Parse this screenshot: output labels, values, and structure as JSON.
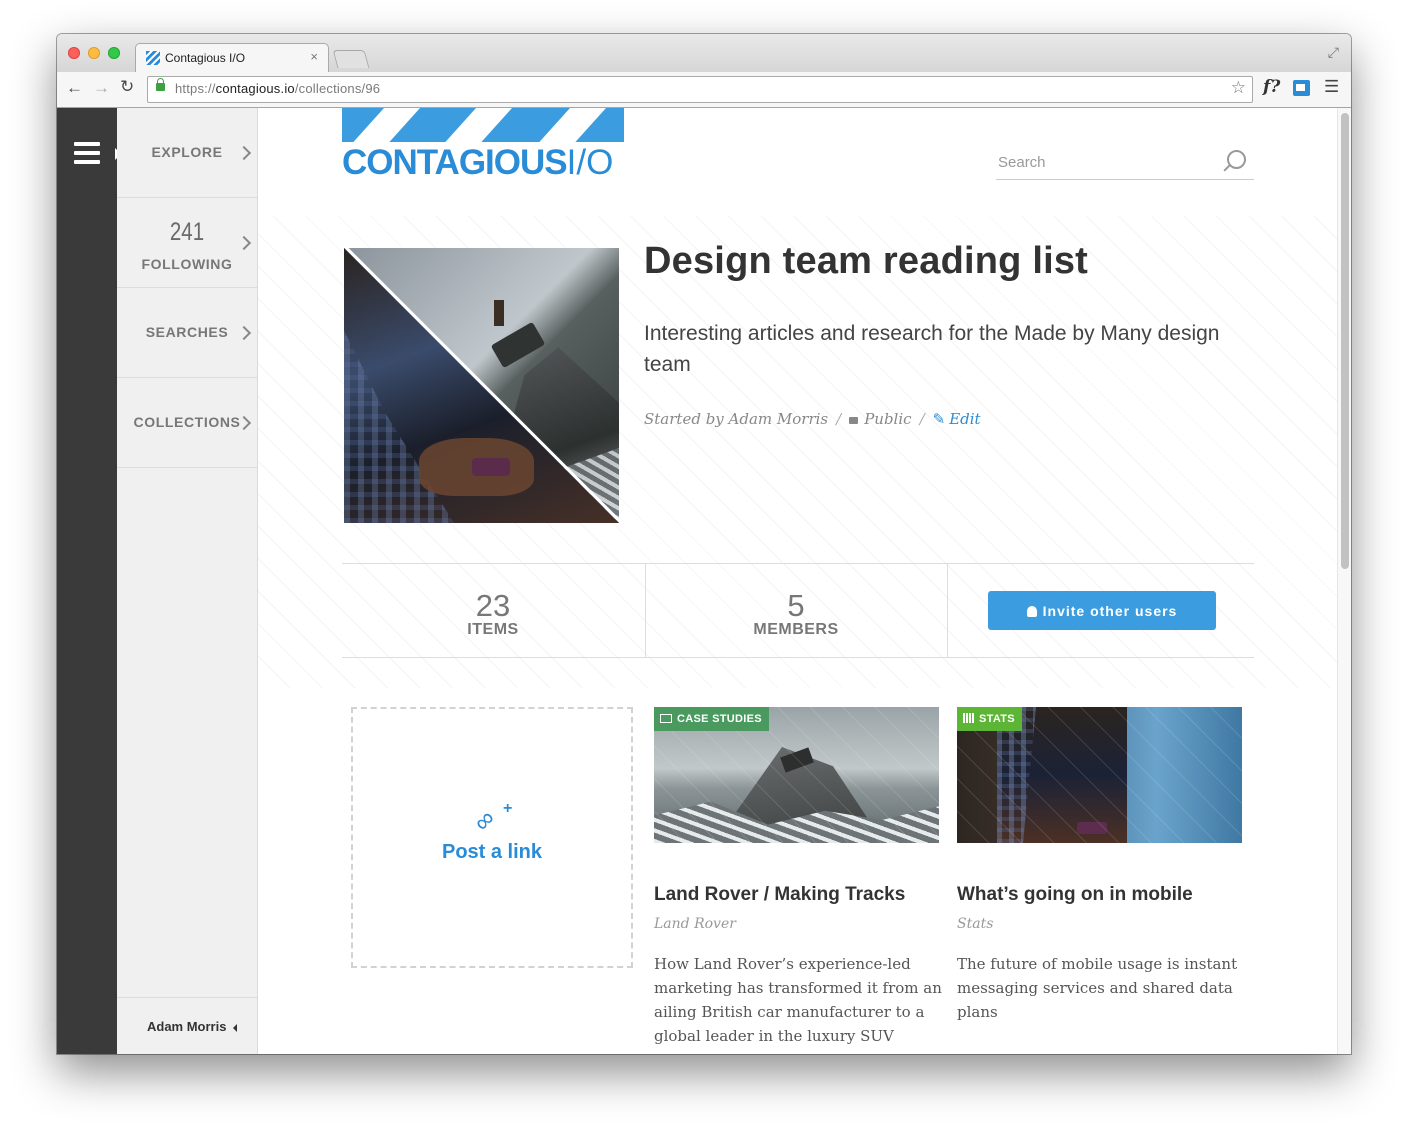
{
  "browser": {
    "tab_title": "Contagious I/O",
    "url_scheme": "https://",
    "url_host": "contagious.io",
    "url_path": "/collections/96",
    "close_glyph": "×",
    "back_glyph": "←",
    "forward_glyph": "→",
    "reload_glyph": "↻",
    "bookmark_glyph": "☆",
    "ext_label": "f?",
    "menu_glyph": "☰",
    "fullscreen_glyph": "⤢"
  },
  "sidebar": {
    "items": [
      {
        "label": "EXPLORE"
      },
      {
        "count": "241",
        "label": "FOLLOWING"
      },
      {
        "label": "SEARCHES"
      },
      {
        "label": "COLLECTIONS"
      }
    ],
    "user": "Adam Morris"
  },
  "logo": {
    "main": "CONTAGIOUS",
    "suffix": "I/O"
  },
  "search": {
    "placeholder": "Search"
  },
  "collection": {
    "title": "Design team reading list",
    "description": "Interesting articles and research for the Made by Many design team",
    "started_by": "Started by Adam Morris",
    "separator": "/",
    "visibility": "Public",
    "edit_label": "Edit"
  },
  "stats": {
    "items_count": "23",
    "items_label": "ITEMS",
    "members_count": "5",
    "members_label": "MEMBERS",
    "invite_label": "Invite other users"
  },
  "post_link": {
    "label": "Post a link",
    "plus": "+",
    "link_glyph": "∞"
  },
  "cards": [
    {
      "tag": "CASE STUDIES",
      "title": "Land Rover / Making Tracks",
      "source": "Land Rover",
      "description": "How Land Rover’s experience-led marketing has transformed it from an ailing British car manufacturer to a global leader in the luxury SUV market"
    },
    {
      "tag": "STATS",
      "title": "What’s going on in mobile",
      "source": "Stats",
      "description": "The future of mobile usage is instant messaging services and shared data plans"
    }
  ],
  "colors": {
    "brand_blue": "#3b9de0",
    "link_blue": "#2a8bd6",
    "tag_case_studies": "#4a9a5f",
    "tag_stats": "#5cb534",
    "sidebar_dark": "#3a3a3a",
    "sidebar_light": "#f0f0f0"
  }
}
